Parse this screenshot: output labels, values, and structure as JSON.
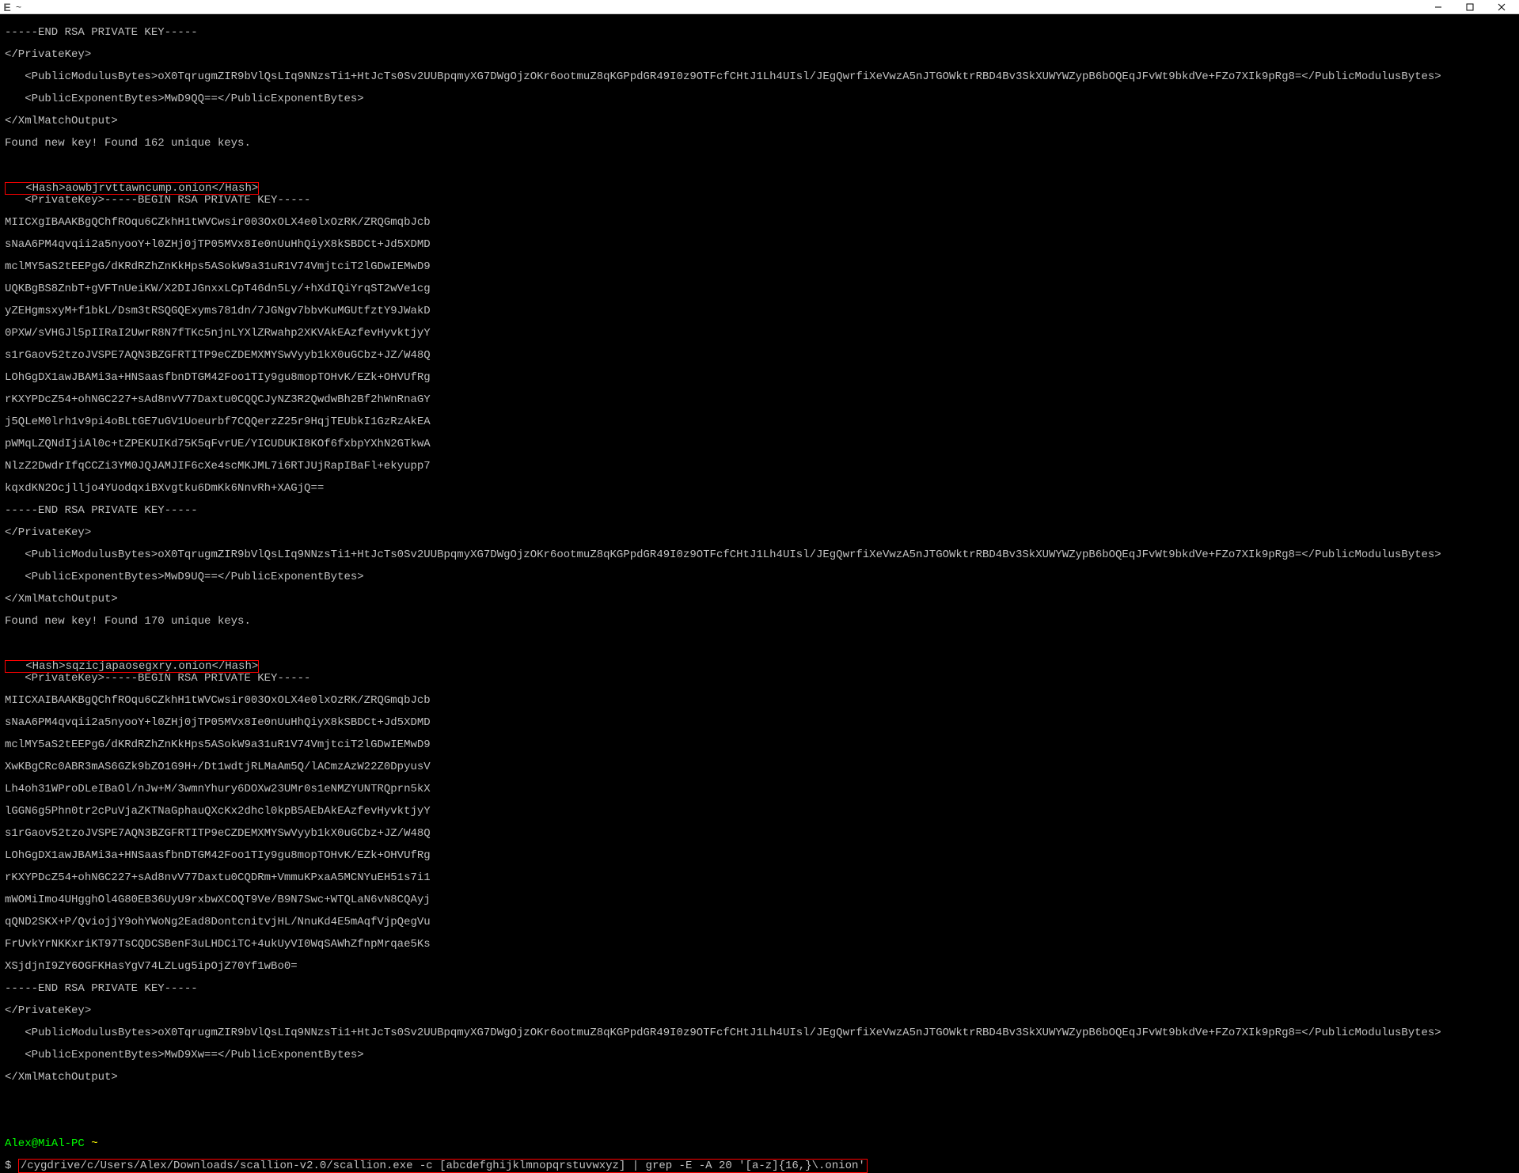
{
  "window": {
    "title": "~"
  },
  "terminal": {
    "block1": {
      "end_key": "-----END RSA PRIVATE KEY-----",
      "private_key_close": "</PrivateKey>",
      "modulus": "   <PublicModulusBytes>oX0TqrugmZIR9bVlQsLIq9NNzsTi1+HtJcTs0Sv2UUBpqmyXG7DWgOjzOKr6ootmuZ8qKGPpdGR49I0z9OTFcfCHtJ1Lh4UIsl/JEgQwrfiXeVwzA5nJTGOWktrRBD4Bv3SkXUWYWZypB6bOQEqJFvWt9bkdVe+FZo7XIk9pRg8=</PublicModulusBytes>",
      "exponent": "   <PublicExponentBytes>MwD9QQ==</PublicExponentBytes>",
      "xml_close": "</XmlMatchOutput>",
      "found": "Found new key! Found 162 unique keys."
    },
    "hash1": "   <Hash>aowbjrvttawncump.onion</Hash>",
    "block2": {
      "private_key_open": "   <PrivateKey>-----BEGIN RSA PRIVATE KEY-----",
      "l1": "MIICXgIBAAKBgQChfROqu6CZkhH1tWVCwsir003OxOLX4e0lxOzRK/ZRQGmqbJcb",
      "l2": "sNaA6PM4qvqii2a5nyooY+l0ZHj0jTP05MVx8Ie0nUuHhQiyX8kSBDCt+Jd5XDMD",
      "l3": "mclMY5aS2tEEPgG/dKRdRZhZnKkHps5ASokW9a31uR1V74VmjtciT2lGDwIEMwD9",
      "l4": "UQKBgBS8ZnbT+gVFTnUeiKW/X2DIJGnxxLCpT46dn5Ly/+hXdIQiYrqST2wVe1cg",
      "l5": "yZEHgmsxyM+f1bkL/Dsm3tRSQGQExyms781dn/7JGNgv7bbvKuMGUtfztY9JWakD",
      "l6": "0PXW/sVHGJl5pIIRaI2UwrR8N7fTKc5njnLYXlZRwahp2XKVAkEAzfevHyvktjyY",
      "l7": "s1rGaov52tzoJVSPE7AQN3BZGFRTITP9eCZDEMXMYSwVyyb1kX0uGCbz+JZ/W48Q",
      "l8": "LOhGgDX1awJBAMi3a+HNSaasfbnDTGM42Foo1TIy9gu8mopTOHvK/EZk+OHVUfRg",
      "l9": "rKXYPDcZ54+ohNGC227+sAd8nvV77Daxtu0CQQCJyNZ3R2QwdwBh2Bf2hWnRnaGY",
      "l10": "j5QLeM0lrh1v9pi4oBLtGE7uGV1Uoeurbf7CQQerzZ25r9HqjTEUbkI1GzRzAkEA",
      "l11": "pWMqLZQNdIjiAl0c+tZPEKUIKd75K5qFvrUE/YICUDUKI8KOf6fxbpYXhN2GTkwA",
      "l12": "NlzZ2DwdrIfqCCZi3YM0JQJAMJIF6cXe4scMKJML7i6RTJUjRapIBaFl+ekyupp7",
      "l13": "kqxdKN2Ocjlljo4YUodqxiBXvgtku6DmKk6NnvRh+XAGjQ==",
      "end_key": "-----END RSA PRIVATE KEY-----",
      "private_key_close": "</PrivateKey>",
      "modulus": "   <PublicModulusBytes>oX0TqrugmZIR9bVlQsLIq9NNzsTi1+HtJcTs0Sv2UUBpqmyXG7DWgOjzOKr6ootmuZ8qKGPpdGR49I0z9OTFcfCHtJ1Lh4UIsl/JEgQwrfiXeVwzA5nJTGOWktrRBD4Bv3SkXUWYWZypB6bOQEqJFvWt9bkdVe+FZo7XIk9pRg8=</PublicModulusBytes>",
      "exponent": "   <PublicExponentBytes>MwD9UQ==</PublicExponentBytes>",
      "xml_close": "</XmlMatchOutput>",
      "found": "Found new key! Found 170 unique keys."
    },
    "hash2": "   <Hash>sqzicjapaosegxry.onion</Hash>",
    "block3": {
      "private_key_open": "   <PrivateKey>-----BEGIN RSA PRIVATE KEY-----",
      "l1": "MIICXAIBAAKBgQChfROqu6CZkhH1tWVCwsir003OxOLX4e0lxOzRK/ZRQGmqbJcb",
      "l2": "sNaA6PM4qvqii2a5nyooY+l0ZHj0jTP05MVx8Ie0nUuHhQiyX8kSBDCt+Jd5XDMD",
      "l3": "mclMY5aS2tEEPgG/dKRdRZhZnKkHps5ASokW9a31uR1V74VmjtciT2lGDwIEMwD9",
      "l4": "XwKBgCRc0ABR3mAS6GZk9bZO1G9H+/Dt1wdtjRLMaAm5Q/lACmzAzW22Z0DpyusV",
      "l5": "Lh4oh31WProDLeIBaOl/nJw+M/3wmnYhury6DOXw23UMr0s1eNMZYUNTRQprn5kX",
      "l6": "lGGN6g5Phn0tr2cPuVjaZKTNaGphauQXcKx2dhcl0kpB5AEbAkEAzfevHyvktjyY",
      "l7": "s1rGaov52tzoJVSPE7AQN3BZGFRTITP9eCZDEMXMYSwVyyb1kX0uGCbz+JZ/W48Q",
      "l8": "LOhGgDX1awJBAMi3a+HNSaasfbnDTGM42Foo1TIy9gu8mopTOHvK/EZk+OHVUfRg",
      "l9": "rKXYPDcZ54+ohNGC227+sAd8nvV77Daxtu0CQDRm+VmmuKPxaA5MCNYuEH51s7i1",
      "l10": "mWOMiImo4UHgghOl4G80EB36UyU9rxbwXCOQT9Ve/B9N7Swc+WTQLaN6vN8CQAyj",
      "l11": "qQND2SKX+P/QviojjY9ohYWoNg2Ead8DontcnitvjHL/NnuKd4E5mAqfVjpQegVu",
      "l12": "FrUvkYrNKKxriKT97TsCQDCSBenF3uLHDCiTC+4ukUyVI0WqSAWhZfnpMrqae5Ks",
      "l13": "XSjdjnI9ZY6OGFKHasYgV74LZLug5ipOjZ70Yf1wBo0=",
      "end_key": "-----END RSA PRIVATE KEY-----",
      "private_key_close": "</PrivateKey>",
      "modulus": "   <PublicModulusBytes>oX0TqrugmZIR9bVlQsLIq9NNzsTi1+HtJcTs0Sv2UUBpqmyXG7DWgOjzOKr6ootmuZ8qKGPpdGR49I0z9OTFcfCHtJ1Lh4UIsl/JEgQwrfiXeVwzA5nJTGOWktrRBD4Bv3SkXUWYWZypB6bOQEqJFvWt9bkdVe+FZo7XIk9pRg8=</PublicModulusBytes>",
      "exponent": "   <PublicExponentBytes>MwD9Xw==</PublicExponentBytes>",
      "xml_close": "</XmlMatchOutput>"
    },
    "prompt": {
      "user": "Alex@MiAl-PC",
      "path": " ~",
      "dollar": "$ ",
      "command": "/cygdrive/c/Users/Alex/Downloads/scallion-v2.0/scallion.exe -c [abcdefghijklmnopqrstuvwxyz] | grep -E -A 20 '[a-z]{16,}\\.onion'"
    }
  }
}
